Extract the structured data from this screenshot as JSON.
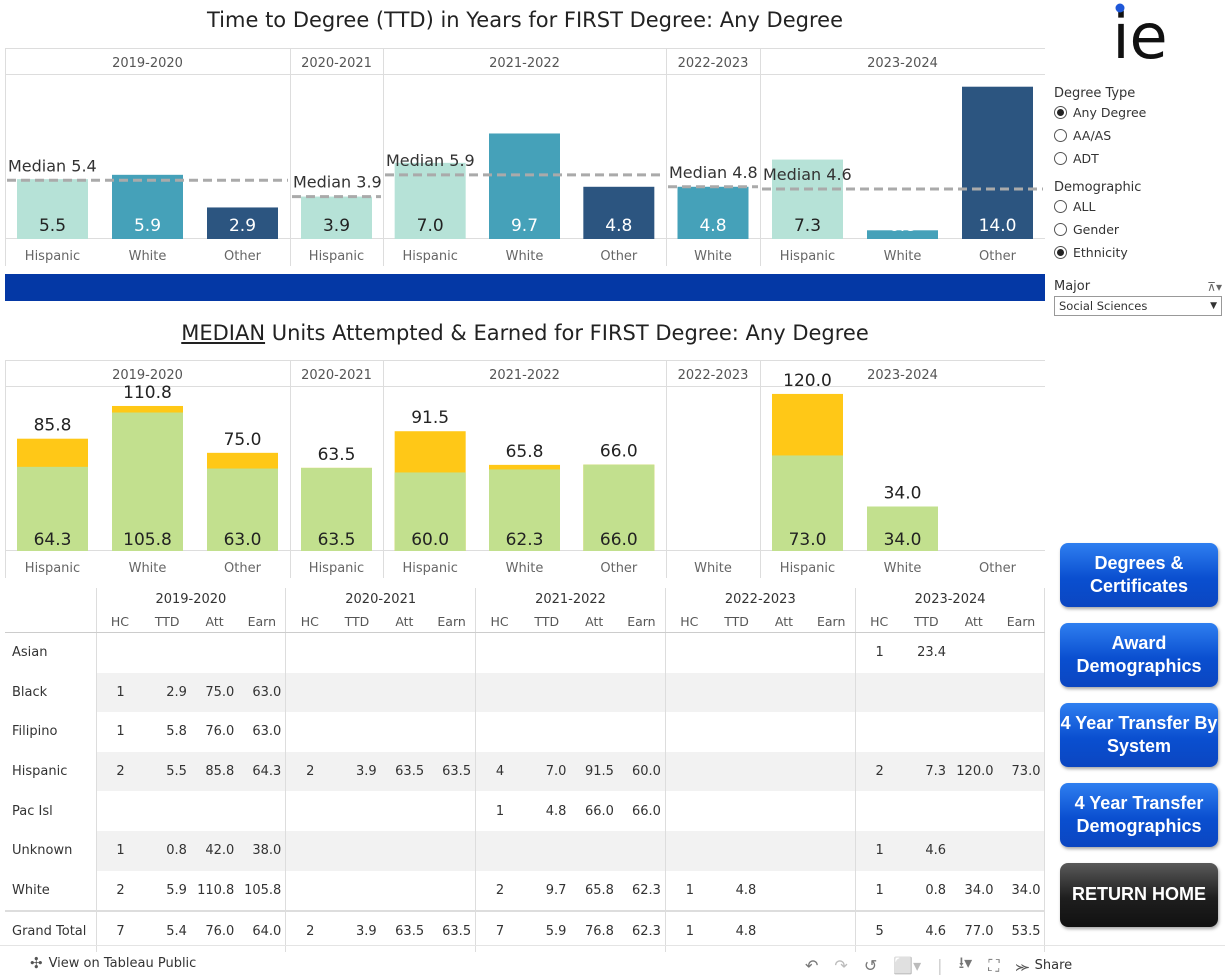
{
  "ttd_title": "Time to Degree (TTD) in Years for FIRST Degree: Any Degree",
  "units_title_prefix": "MEDIAN",
  "units_title_rest": " Units Attempted & Earned for FIRST Degree: Any Degree",
  "logo_text": "ie",
  "controls": {
    "degree_type": {
      "label": "Degree Type",
      "options": [
        "Any Degree",
        "AA/AS",
        "ADT"
      ],
      "selected": 0
    },
    "demographic": {
      "label": "Demographic",
      "options": [
        "ALL",
        "Gender",
        "Ethnicity"
      ],
      "selected": 2
    },
    "major": {
      "label": "Major",
      "value": "Social Sciences"
    }
  },
  "nav_buttons": [
    {
      "label": "Degrees & Certificates",
      "style": "blue"
    },
    {
      "label": "Award Demographics",
      "style": "blue"
    },
    {
      "label": "4 Year Transfer By System",
      "style": "blue"
    },
    {
      "label": "4 Year Transfer Demographics",
      "style": "blue"
    },
    {
      "label": "RETURN HOME",
      "style": "black"
    }
  ],
  "colors": {
    "Hispanic": "#b6e2d7",
    "White": "#45a1b9",
    "Other": "#2c5580",
    "median_line": "#aaaaaa",
    "earned": "#c2e08e",
    "attempted": "#ffc817",
    "band": "#0438a5"
  },
  "chart_data": [
    {
      "type": "bar",
      "title": "Time to Degree (TTD) in Years for FIRST Degree: Any Degree",
      "ylim": [
        0,
        14.8
      ],
      "grid": false,
      "groups": [
        {
          "year": "2019-2020",
          "bars": [
            {
              "category": "Hispanic",
              "value": 5.5
            },
            {
              "category": "White",
              "value": 5.9
            },
            {
              "category": "Other",
              "value": 2.9
            }
          ],
          "median": 5.4,
          "median_label": "Median 5.4"
        },
        {
          "year": "2020-2021",
          "bars": [
            {
              "category": "Hispanic",
              "value": 3.9
            }
          ],
          "median": 3.9,
          "median_label": "Median 3.9"
        },
        {
          "year": "2021-2022",
          "bars": [
            {
              "category": "Hispanic",
              "value": 7.0
            },
            {
              "category": "White",
              "value": 9.7
            },
            {
              "category": "Other",
              "value": 4.8
            }
          ],
          "median": 5.9,
          "median_label": "Median 5.9"
        },
        {
          "year": "2022-2023",
          "bars": [
            {
              "category": "White",
              "value": 4.8
            }
          ],
          "median": 4.8,
          "median_label": "Median 4.8"
        },
        {
          "year": "2023-2024",
          "bars": [
            {
              "category": "Hispanic",
              "value": 7.3
            },
            {
              "category": "White",
              "value": 0.8
            },
            {
              "category": "Other",
              "value": 14.0
            }
          ],
          "median": 4.6,
          "median_label": "Median 4.6"
        }
      ]
    },
    {
      "type": "bar",
      "title": "MEDIAN Units Attempted & Earned for FIRST Degree: Any Degree",
      "ylim": [
        0,
        123
      ],
      "grid": false,
      "groups": [
        {
          "year": "2019-2020",
          "bars": [
            {
              "category": "Hispanic",
              "earned": 64.3,
              "attempted": 85.8
            },
            {
              "category": "White",
              "earned": 105.8,
              "attempted": 110.8
            },
            {
              "category": "Other",
              "earned": 63.0,
              "attempted": 75.0
            }
          ]
        },
        {
          "year": "2020-2021",
          "bars": [
            {
              "category": "Hispanic",
              "earned": 63.5,
              "attempted": 63.5
            }
          ]
        },
        {
          "year": "2021-2022",
          "bars": [
            {
              "category": "Hispanic",
              "earned": 60.0,
              "attempted": 91.5
            },
            {
              "category": "White",
              "earned": 62.3,
              "attempted": 65.8
            },
            {
              "category": "Other",
              "earned": 66.0,
              "attempted": 66.0
            }
          ]
        },
        {
          "year": "2022-2023",
          "bars": [
            {
              "category": "White",
              "earned": null,
              "attempted": null
            }
          ]
        },
        {
          "year": "2023-2024",
          "bars": [
            {
              "category": "Hispanic",
              "earned": 73.0,
              "attempted": 120.0
            },
            {
              "category": "White",
              "earned": 34.0,
              "attempted": 34.0
            },
            {
              "category": "Other",
              "earned": null,
              "attempted": null
            }
          ]
        }
      ]
    },
    {
      "type": "table",
      "years": [
        "2019-2020",
        "2020-2021",
        "2021-2022",
        "2022-2023",
        "2023-2024"
      ],
      "columns": [
        "HC",
        "TTD",
        "Att",
        "Earn"
      ],
      "rows": [
        {
          "label": "Asian",
          "cells": [
            [
              "",
              "",
              "",
              ""
            ],
            [
              "",
              "",
              "",
              ""
            ],
            [
              "",
              "",
              "",
              ""
            ],
            [
              "",
              "",
              "",
              ""
            ],
            [
              "1",
              "23.4",
              "",
              ""
            ]
          ]
        },
        {
          "label": "Black",
          "cells": [
            [
              "1",
              "2.9",
              "75.0",
              "63.0"
            ],
            [
              "",
              "",
              "",
              ""
            ],
            [
              "",
              "",
              "",
              ""
            ],
            [
              "",
              "",
              "",
              ""
            ],
            [
              "",
              "",
              "",
              ""
            ]
          ]
        },
        {
          "label": "Filipino",
          "cells": [
            [
              "1",
              "5.8",
              "76.0",
              "63.0"
            ],
            [
              "",
              "",
              "",
              ""
            ],
            [
              "",
              "",
              "",
              ""
            ],
            [
              "",
              "",
              "",
              ""
            ],
            [
              "",
              "",
              "",
              ""
            ]
          ]
        },
        {
          "label": "Hispanic",
          "cells": [
            [
              "2",
              "5.5",
              "85.8",
              "64.3"
            ],
            [
              "2",
              "3.9",
              "63.5",
              "63.5"
            ],
            [
              "4",
              "7.0",
              "91.5",
              "60.0"
            ],
            [
              "",
              "",
              "",
              ""
            ],
            [
              "2",
              "7.3",
              "120.0",
              "73.0"
            ]
          ]
        },
        {
          "label": "Pac Isl",
          "cells": [
            [
              "",
              "",
              "",
              ""
            ],
            [
              "",
              "",
              "",
              ""
            ],
            [
              "1",
              "4.8",
              "66.0",
              "66.0"
            ],
            [
              "",
              "",
              "",
              ""
            ],
            [
              "",
              "",
              "",
              ""
            ]
          ]
        },
        {
          "label": "Unknown",
          "cells": [
            [
              "1",
              "0.8",
              "42.0",
              "38.0"
            ],
            [
              "",
              "",
              "",
              ""
            ],
            [
              "",
              "",
              "",
              ""
            ],
            [
              "",
              "",
              "",
              ""
            ],
            [
              "1",
              "4.6",
              "",
              ""
            ]
          ]
        },
        {
          "label": "White",
          "cells": [
            [
              "2",
              "5.9",
              "110.8",
              "105.8"
            ],
            [
              "",
              "",
              "",
              ""
            ],
            [
              "2",
              "9.7",
              "65.8",
              "62.3"
            ],
            [
              "1",
              "4.8",
              "",
              ""
            ],
            [
              "1",
              "0.8",
              "34.0",
              "34.0"
            ]
          ]
        },
        {
          "label": "Grand Total",
          "cells": [
            [
              "7",
              "5.4",
              "76.0",
              "64.0"
            ],
            [
              "2",
              "3.9",
              "63.5",
              "63.5"
            ],
            [
              "7",
              "5.9",
              "76.8",
              "62.3"
            ],
            [
              "1",
              "4.8",
              "",
              ""
            ],
            [
              "5",
              "4.6",
              "77.0",
              "53.5"
            ]
          ]
        }
      ]
    }
  ],
  "footer": {
    "view_link": "View on Tableau Public",
    "share": "Share"
  }
}
